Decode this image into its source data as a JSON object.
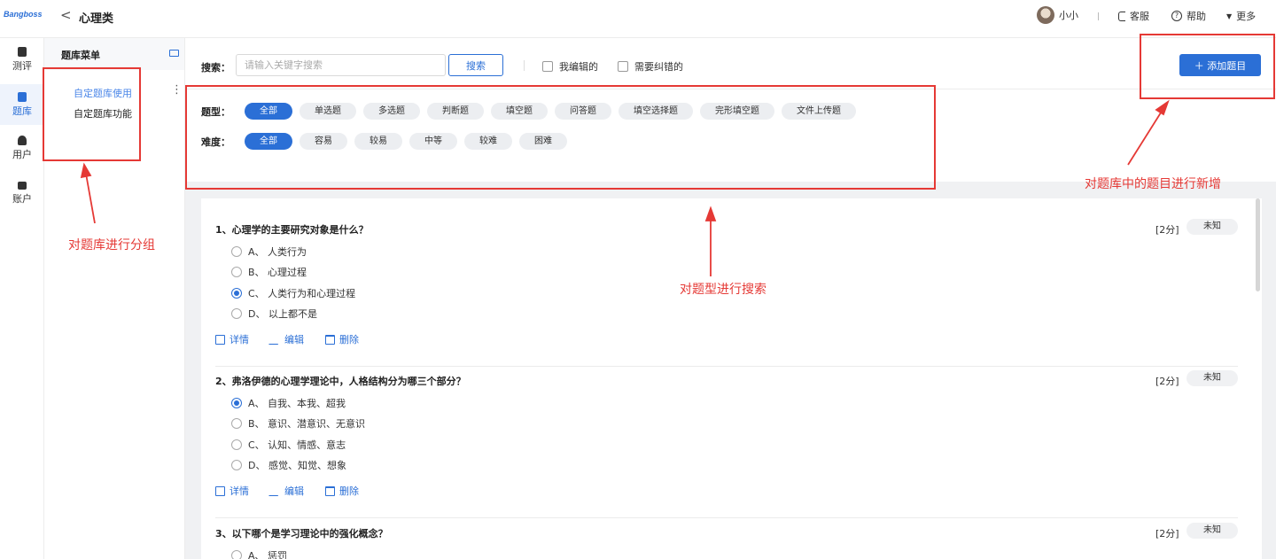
{
  "header": {
    "logo": "Bangboss",
    "back_symbol": "<",
    "title": "心理类",
    "user_name": "小小",
    "service": "客服",
    "help": "帮助",
    "more": "更多"
  },
  "nav": {
    "items": [
      {
        "label": "测评",
        "icon": "clipboard-check-icon"
      },
      {
        "label": "题库",
        "icon": "book-icon",
        "active": true
      },
      {
        "label": "用户",
        "icon": "user-icon"
      },
      {
        "label": "账户",
        "icon": "wallet-icon"
      }
    ]
  },
  "menu": {
    "title": "题库菜单",
    "items": [
      "自定题库使用",
      "自定题库功能"
    ]
  },
  "toolbar": {
    "search_label": "搜索：",
    "search_placeholder": "请输入关键字搜索",
    "search_button": "搜索",
    "check_my_edits": "我编辑的",
    "check_needs_fix": "需要纠错的",
    "add_button": "＋ 添加题目"
  },
  "filters": {
    "type_label": "题型：",
    "types": [
      "全部",
      "单选题",
      "多选题",
      "判断题",
      "填空题",
      "问答题",
      "填空选择题",
      "完形填空题",
      "文件上传题"
    ],
    "difficulty_label": "难度：",
    "difficulties": [
      "全部",
      "容易",
      "较易",
      "中等",
      "较难",
      "困难"
    ]
  },
  "questions": [
    {
      "title": "1、心理学的主要研究对象是什么？",
      "score": "[2分]",
      "status": "未知",
      "options": [
        "A、 人类行为",
        "B、 心理过程",
        "C、 人类行为和心理过程",
        "D、 以上都不是"
      ],
      "selected": 2
    },
    {
      "title": "2、弗洛伊德的心理学理论中，人格结构分为哪三个部分？",
      "score": "[2分]",
      "status": "未知",
      "options": [
        "A、 自我、本我、超我",
        "B、 意识、潜意识、无意识",
        "C、 认知、情感、意志",
        "D、 感觉、知觉、想象"
      ],
      "selected": 0
    },
    {
      "title": "3、以下哪个是学习理论中的强化概念？",
      "score": "[2分]",
      "status": "未知",
      "options": [
        "A、 惩罚"
      ],
      "selected": -1
    }
  ],
  "actions": {
    "detail": "详情",
    "edit": "编辑",
    "delete": "删除"
  },
  "annotations": {
    "group_note": "对题库进行分组",
    "search_note": "对题型进行搜索",
    "add_note": "对题库中的题目进行新增"
  },
  "colors": {
    "accent": "#2b6fd6",
    "annotation": "#e53935"
  }
}
